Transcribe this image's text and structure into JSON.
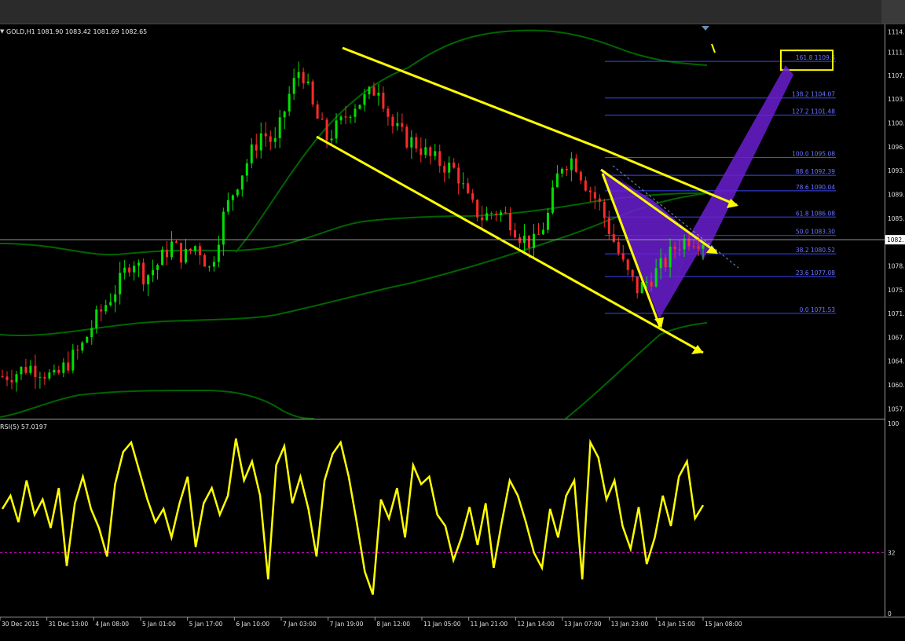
{
  "symbol_header": "GOLD,H1  1081.90 1083.42 1081.69 1082.65",
  "rsi_header": "RSI(5) 57.0197",
  "colors": {
    "bull": "#00e000",
    "bear": "#ff2b2b",
    "trend": "#ffff00",
    "bands": "#006400",
    "fib": "#3b47ff",
    "fib_text": "#6b74ff",
    "harmonic": "#6a1fd0",
    "rsi": "#ffff00",
    "rsi_level": "#c000c0"
  },
  "chart_data": [
    {
      "type": "candlestick",
      "title": "GOLD,H1",
      "ylim": [
        1055.6,
        1115.2
      ],
      "price_ticks": [
        "1114.",
        "1111.",
        "1107.",
        "1103.",
        "1100.",
        "1096.",
        "1093.",
        "1089.",
        "1085.",
        "1082.",
        "1078.",
        "1075.",
        "1071.",
        "1067.",
        "1064.",
        "1060.",
        "1057."
      ],
      "price_tick_values": [
        1114.1,
        1111.0,
        1107.5,
        1103.9,
        1100.3,
        1096.7,
        1093.1,
        1089.5,
        1085.9,
        1082.5,
        1078.7,
        1075.1,
        1071.5,
        1067.9,
        1064.3,
        1060.7,
        1057.1
      ],
      "current_price": 1082.65,
      "current_price_label": "1082.",
      "time_labels": [
        "30 Dec 2015",
        "31 Dec 13:00",
        "4 Jan 08:00",
        "5 Jan 01:00",
        "5 Jan 17:00",
        "6 Jan 10:00",
        "7 Jan 03:00",
        "7 Jan 19:00",
        "8 Jan 12:00",
        "11 Jan 05:00",
        "11 Jan 21:00",
        "12 Jan 14:00",
        "13 Jan 07:00",
        "13 Jan 23:00",
        "14 Jan 15:00",
        "15 Jan 08:00"
      ],
      "price_path": [
        1062,
        1062.5,
        1063.5,
        1063,
        1061.5,
        1064,
        1066,
        1070,
        1073,
        1076,
        1080,
        1077,
        1079,
        1082,
        1080,
        1082,
        1078,
        1086,
        1091,
        1095,
        1099,
        1097,
        1104,
        1109,
        1102,
        1098,
        1100,
        1103,
        1104,
        1106,
        1100,
        1098,
        1097,
        1095,
        1094,
        1093,
        1088,
        1086,
        1087,
        1086,
        1083,
        1082,
        1086,
        1094,
        1095,
        1091,
        1088,
        1083,
        1078,
        1075,
        1077,
        1079,
        1082,
        1083,
        1082.65
      ],
      "fibonacci": [
        {
          "label": "161.8  1109.6",
          "level": 1109.6
        },
        {
          "label": "138.2  1104.07",
          "level": 1104.07
        },
        {
          "label": "127.2  1101.48",
          "level": 1101.48
        },
        {
          "label": "100.0  1095.08",
          "level": 1095.08
        },
        {
          "label": "88.6  1092.39",
          "level": 1092.39
        },
        {
          "label": "78.6  1090.04",
          "level": 1090.04
        },
        {
          "label": "61.8  1086.08",
          "level": 1086.08
        },
        {
          "label": "50.0  1083.30",
          "level": 1083.3
        },
        {
          "label": "38.2  1080.52",
          "level": 1080.52
        },
        {
          "label": "23.6  1077.08",
          "level": 1077.08
        },
        {
          "label": "0.0  1071.53",
          "level": 1071.53
        }
      ],
      "indicators": [
        "Bollinger Bands",
        "Moving Average",
        "Trend Channel",
        "Harmonic Pattern"
      ]
    },
    {
      "type": "line",
      "title": "RSI(5) 57.0197",
      "ylim": [
        0,
        100
      ],
      "ticks": [
        "100",
        "32",
        "0"
      ],
      "tick_values": [
        100,
        32,
        0
      ],
      "level": 32,
      "last_value": 57.0197,
      "values": [
        55,
        62,
        48,
        70,
        52,
        60,
        45,
        66,
        25,
        58,
        72,
        55,
        45,
        30,
        68,
        85,
        90,
        75,
        60,
        48,
        55,
        40,
        58,
        72,
        35,
        58,
        66,
        52,
        62,
        92,
        70,
        80,
        62,
        18,
        78,
        88,
        58,
        72,
        55,
        30,
        70,
        84,
        90,
        72,
        48,
        22,
        10,
        60,
        50,
        66,
        40,
        78,
        68,
        72,
        52,
        46,
        28,
        40,
        56,
        36,
        58,
        24,
        48,
        70,
        62,
        48,
        32,
        24,
        55,
        40,
        62,
        70,
        18,
        90,
        82,
        60,
        70,
        46,
        34,
        56,
        26,
        40,
        62,
        46,
        72,
        80,
        50,
        57
      ]
    }
  ]
}
